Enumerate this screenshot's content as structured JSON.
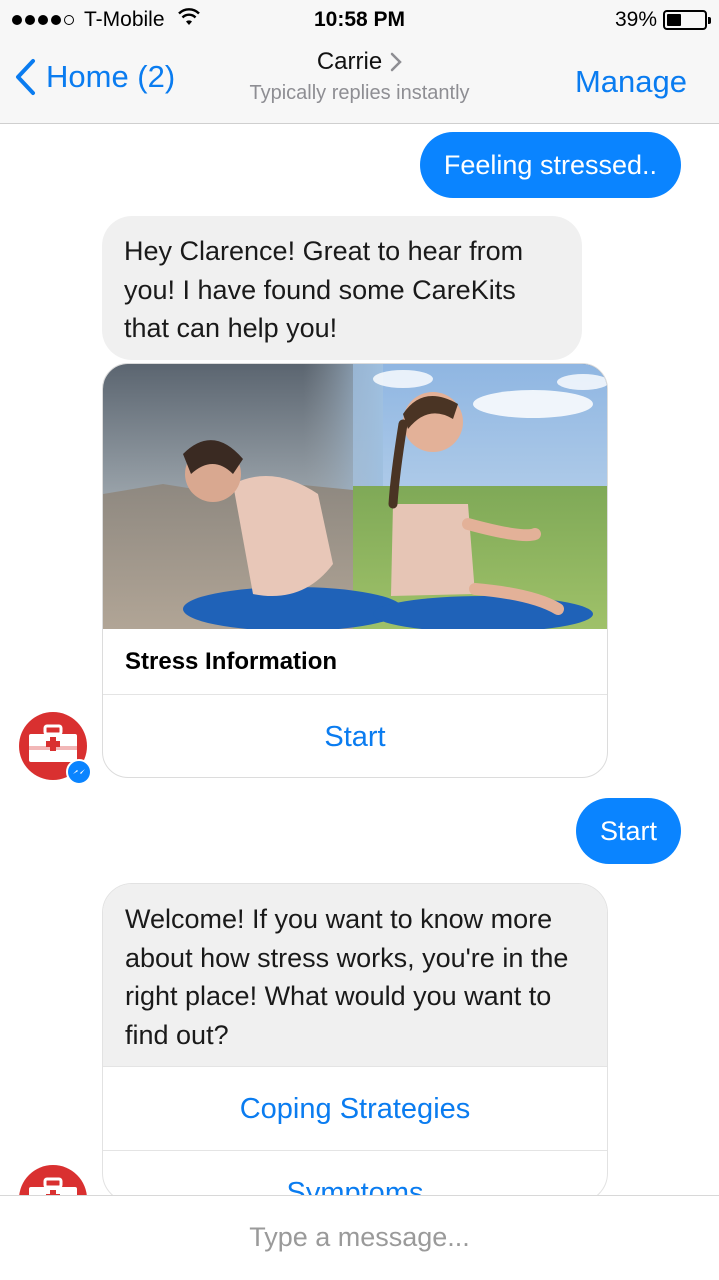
{
  "status_bar": {
    "carrier": "T-Mobile",
    "time": "10:58 PM",
    "battery_percent": "39%",
    "battery_level": 0.39,
    "signal_bars": 4,
    "signal_icon": "signal-dots-icon",
    "wifi_icon": "wifi-icon",
    "battery_icon": "battery-icon"
  },
  "nav": {
    "back_label": "Home (2)",
    "title": "Carrie",
    "subtitle": "Typically replies instantly",
    "manage_label": "Manage",
    "accent_color": "#0a7cf0"
  },
  "messages": {
    "outgoing_1": "Feeling stressed..",
    "incoming_1": "Hey Clarence! Great to hear from you! I have found some CareKits that can help you!",
    "card": {
      "title": "Stress Information",
      "button_label": "Start"
    },
    "outgoing_2": "Start",
    "welcome": {
      "text": "Welcome! If you want to know more about how stress works, you're in the right place! What would you want to find out?",
      "options": [
        "Coping Strategies",
        "Symptoms"
      ]
    }
  },
  "composer": {
    "placeholder": "Type a message..."
  }
}
